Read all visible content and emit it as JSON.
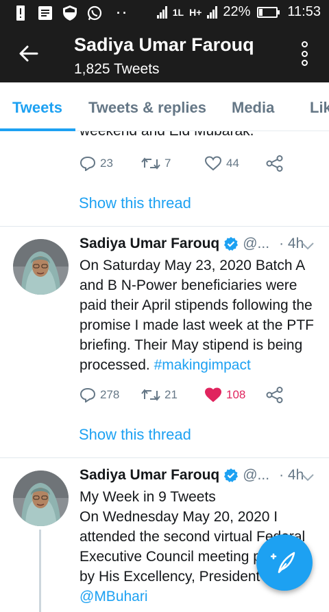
{
  "status_bar": {
    "icons": [
      "alert-icon",
      "document-icon",
      "shield-icon",
      "whatsapp-icon"
    ],
    "network_1": "1L",
    "network_2": "H+",
    "battery": "22%",
    "battery_level": 0.22,
    "time": "11:53"
  },
  "header": {
    "title": "Sadiya Umar Farouq",
    "subtitle": "1,825 Tweets"
  },
  "tabs": [
    {
      "label": "Tweets",
      "active": true
    },
    {
      "label": "Tweets & replies",
      "active": false
    },
    {
      "label": "Media",
      "active": false
    },
    {
      "label": "Lik",
      "active": false
    }
  ],
  "tweets": [
    {
      "text_tail": "weekend and Eid Mubarak.",
      "replies": "23",
      "retweets": "7",
      "likes": "44",
      "liked": false,
      "show_thread": "Show this thread"
    },
    {
      "name": "Sadiya Umar Farouq",
      "handle": "@...",
      "time": "· 4h",
      "text": "On Saturday May 23, 2020 Batch A and B  N-Power beneficiaries were paid their April stipends following the promise I made last week at the PTF briefing. Their May stipend is being processed.",
      "hashtag": "#makingimpact",
      "replies": "278",
      "retweets": "21",
      "likes": "108",
      "liked": true,
      "show_thread": "Show this thread"
    },
    {
      "name": "Sadiya Umar Farouq",
      "handle": "@...",
      "time": "· 4h",
      "line1": "My Week in 9 Tweets",
      "text": "On Wednesday May 20, 2020 I attended the second virtual Federal Executive Council meeting presided by His Excellency, President",
      "mention": "@MBuhari"
    }
  ],
  "colors": {
    "accent": "#1da1f2",
    "like": "#e0245e",
    "header_bg": "#1c1c1c",
    "muted": "#657786"
  }
}
